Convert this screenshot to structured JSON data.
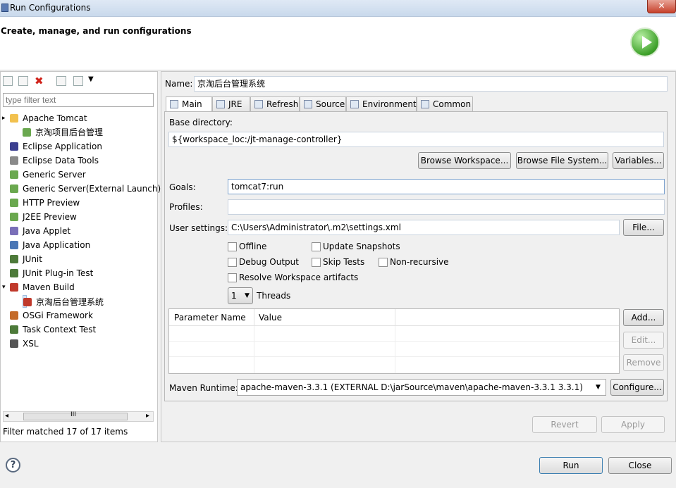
{
  "window": {
    "title": "Run Configurations",
    "close_glyph": "✕"
  },
  "header": {
    "title": "Create, manage, and run configurations"
  },
  "filter": {
    "placeholder": "type filter text"
  },
  "tree": [
    {
      "label": "Apache Tomcat",
      "icon": "tomcat-icon",
      "level": 0,
      "expander": "▸"
    },
    {
      "label": "京淘项目后台管理",
      "icon": "server-config-icon",
      "level": 1
    },
    {
      "label": "Eclipse Application",
      "icon": "eclipse-icon",
      "level": 0
    },
    {
      "label": "Eclipse Data Tools",
      "icon": "database-icon",
      "level": 0
    },
    {
      "label": "Generic Server",
      "icon": "server-icon",
      "level": 0
    },
    {
      "label": "Generic Server(External Launch)",
      "icon": "server-icon",
      "level": 0
    },
    {
      "label": "HTTP Preview",
      "icon": "server-icon",
      "level": 0
    },
    {
      "label": "J2EE Preview",
      "icon": "server-icon",
      "level": 0
    },
    {
      "label": "Java Applet",
      "icon": "applet-icon",
      "level": 0
    },
    {
      "label": "Java Application",
      "icon": "java-app-icon",
      "level": 0
    },
    {
      "label": "JUnit",
      "icon": "junit-icon",
      "level": 0
    },
    {
      "label": "JUnit Plug-in Test",
      "icon": "junit-plugin-icon",
      "level": 0
    },
    {
      "label": "Maven Build",
      "icon": "m2-icon",
      "level": 0,
      "expander": "▾"
    },
    {
      "label": "京淘后台管理系统",
      "icon": "m2-icon",
      "level": 1,
      "selected": true
    },
    {
      "label": "OSGi Framework",
      "icon": "osgi-icon",
      "level": 0
    },
    {
      "label": "Task Context Test",
      "icon": "junit-icon",
      "level": 0
    },
    {
      "label": "XSL",
      "icon": "xsl-icon",
      "level": 0
    }
  ],
  "status": {
    "filter_matched": "Filter matched 17 of 17 items"
  },
  "name": {
    "label": "Name:",
    "value": "京淘后台管理系统"
  },
  "tabs": [
    {
      "label": "Main",
      "active": true
    },
    {
      "label": "JRE"
    },
    {
      "label": "Refresh"
    },
    {
      "label": "Source"
    },
    {
      "label": "Environment"
    },
    {
      "label": "Common"
    }
  ],
  "main": {
    "base_dir_label": "Base directory:",
    "base_dir_value": "${workspace_loc:/jt-manage-controller}",
    "browse_workspace": "Browse Workspace...",
    "browse_fs": "Browse File System...",
    "variables": "Variables...",
    "goals_label": "Goals:",
    "goals_value": "tomcat7:run",
    "profiles_label": "Profiles:",
    "profiles_value": "",
    "user_settings_label": "User settings:",
    "user_settings_value": "C:\\Users\\Administrator\\.m2\\settings.xml",
    "file_button": "File...",
    "offline": "Offline",
    "update_snapshots": "Update Snapshots",
    "debug_output": "Debug Output",
    "skip_tests": "Skip Tests",
    "non_recursive": "Non-recursive",
    "resolve_workspace": "Resolve Workspace artifacts",
    "threads_value": "1",
    "threads_label": "Threads",
    "param_name_header": "Parameter Name",
    "value_header": "Value",
    "add_button": "Add...",
    "edit_button": "Edit...",
    "remove_button": "Remove",
    "maven_runtime_label": "Maven Runtime:",
    "maven_runtime_value": "apache-maven-3.3.1 (EXTERNAL D:\\jarSource\\maven\\apache-maven-3.3.1 3.3.1)",
    "configure_button": "Configure..."
  },
  "actions": {
    "revert": "Revert",
    "apply": "Apply",
    "run": "Run",
    "close": "Close"
  },
  "scrollbar": {
    "grip": "III",
    "left_arrow": "◂",
    "right_arrow": "▸"
  },
  "help_glyph": "?"
}
